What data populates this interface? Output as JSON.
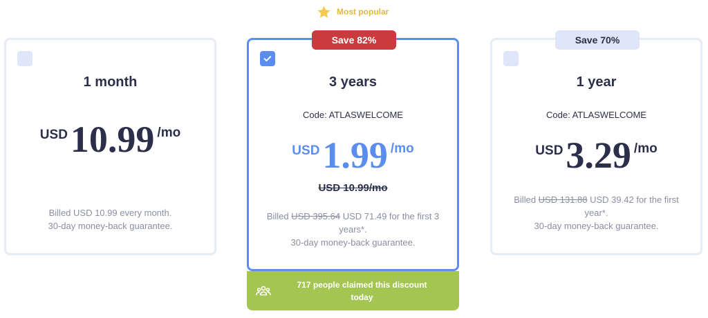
{
  "popular_label": "Most popular",
  "colors": {
    "accent": "#5b8def",
    "badge_red": "#c93b3e",
    "badge_light": "#dfe6f9",
    "claim_green": "#a5c552",
    "star": "#e2b93b"
  },
  "plans": [
    {
      "title": "1 month",
      "checked": false,
      "badge": "",
      "code": "",
      "currency": "USD",
      "amount": "10.99",
      "unit": "/mo",
      "old_price": "",
      "billing_prefix": "Billed USD 10.99 every month.",
      "billing_struck": "",
      "billing_rest": "",
      "guarantee": "30-day money-back guarantee."
    },
    {
      "title": "3 years",
      "checked": true,
      "badge": "Save 82%",
      "code": "Code: ATLASWELCOME",
      "currency": "USD",
      "amount": "1.99",
      "unit": "/mo",
      "old_price": "USD 10.99/mo",
      "billing_prefix": "Billed",
      "billing_struck": "USD 395.64",
      "billing_rest": "USD 71.49 for the first 3 years*.",
      "guarantee": "30-day money-back guarantee."
    },
    {
      "title": "1 year",
      "checked": false,
      "badge": "Save 70%",
      "code": "Code: ATLASWELCOME",
      "currency": "USD",
      "amount": "3.29",
      "unit": "/mo",
      "old_price": "",
      "billing_prefix": "Billed",
      "billing_struck": "USD 131.88",
      "billing_rest": "USD 39.42 for the first year*.",
      "guarantee": "30-day money-back guarantee."
    }
  ],
  "claim": {
    "icon": "people-icon",
    "text_line1": "717 people claimed this discount",
    "text_line2": "today"
  }
}
